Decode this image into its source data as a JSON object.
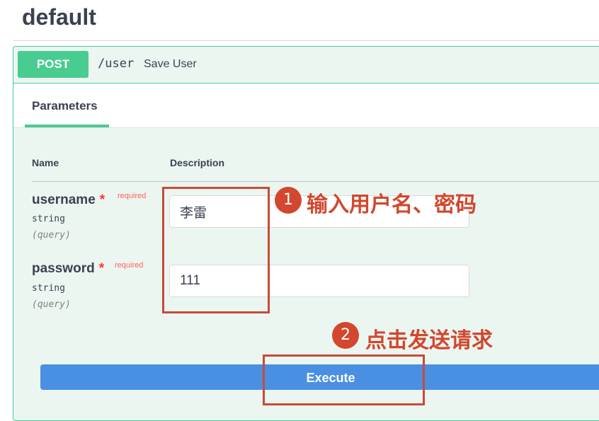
{
  "section": {
    "title": "default"
  },
  "operation": {
    "method": "POST",
    "path": "/user",
    "summary": "Save User",
    "tab_label": "Parameters",
    "columns": {
      "name": "Name",
      "description": "Description"
    },
    "parameters": [
      {
        "name": "username",
        "required_star": "*",
        "required_label": "required",
        "type": "string",
        "in": "(query)",
        "value": "李雷"
      },
      {
        "name": "password",
        "required_star": "*",
        "required_label": "required",
        "type": "string",
        "in": "(query)",
        "value": "111"
      }
    ],
    "execute_label": "Execute"
  },
  "annotations": [
    {
      "number": "1",
      "text": "输入用户名、密码"
    },
    {
      "number": "2",
      "text": "点击发送请求"
    }
  ],
  "colors": {
    "post_green": "#49cc90",
    "execute_blue": "#4990e2",
    "annotation_red": "#d2472d",
    "required_red": "#ff3333"
  }
}
